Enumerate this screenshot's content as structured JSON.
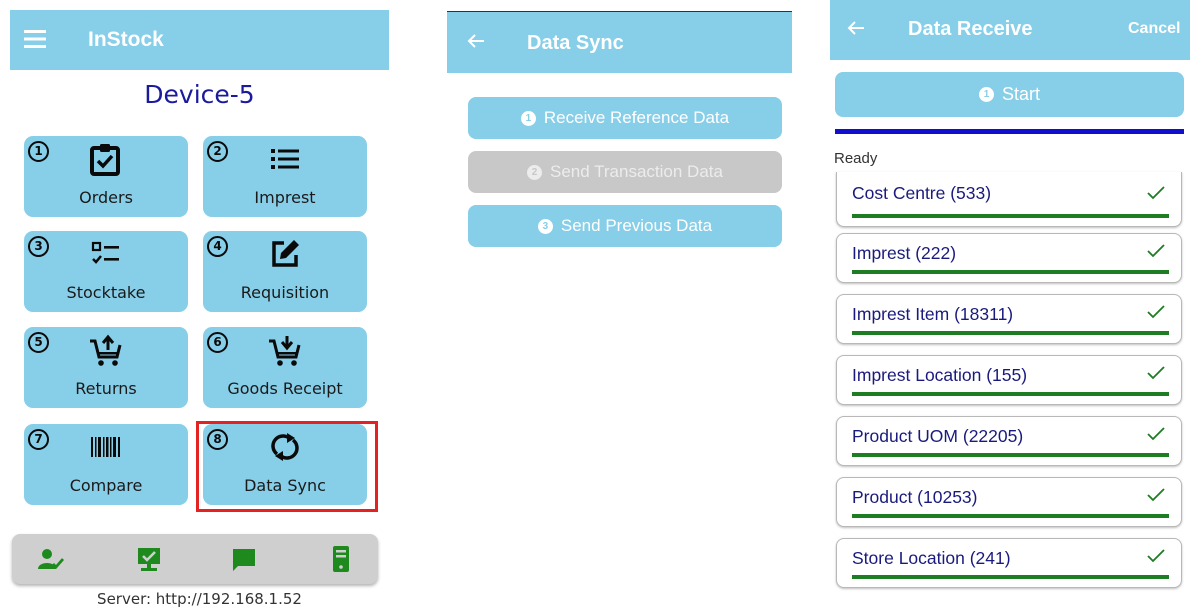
{
  "home": {
    "app_title": "InStock",
    "device_name": "Device-5",
    "tiles": [
      {
        "num": "1",
        "label": "Orders",
        "icon": "clipboard-check-icon"
      },
      {
        "num": "2",
        "label": "Imprest",
        "icon": "list-icon"
      },
      {
        "num": "3",
        "label": "Stocktake",
        "icon": "checklist-icon"
      },
      {
        "num": "4",
        "label": "Requisition",
        "icon": "edit-square-icon"
      },
      {
        "num": "5",
        "label": "Returns",
        "icon": "cart-upload-icon"
      },
      {
        "num": "6",
        "label": "Goods Receipt",
        "icon": "cart-download-icon"
      },
      {
        "num": "7",
        "label": "Compare",
        "icon": "barcode-icon"
      },
      {
        "num": "8",
        "label": "Data Sync",
        "icon": "sync-icon"
      }
    ],
    "bottom_icons": [
      "user-check-icon",
      "monitor-check-icon",
      "chat-icon",
      "phone-device-icon"
    ],
    "server_text": "Server: http://192.168.1.52",
    "highlight_color": "#e52222"
  },
  "sync": {
    "title": "Data Sync",
    "buttons": [
      {
        "num": "1",
        "label": "Receive Reference Data",
        "enabled": true
      },
      {
        "num": "2",
        "label": "Send Transaction Data",
        "enabled": false
      },
      {
        "num": "3",
        "label": "Send Previous Data",
        "enabled": true
      }
    ]
  },
  "receive": {
    "title": "Data Receive",
    "cancel_label": "Cancel",
    "start_num": "1",
    "start_label": "Start",
    "status": "Ready",
    "items": [
      {
        "label": "Cost Centre  (533)",
        "done": true
      },
      {
        "label": "Imprest  (222)",
        "done": true
      },
      {
        "label": "Imprest Item  (18311)",
        "done": true
      },
      {
        "label": "Imprest Location  (155)",
        "done": true
      },
      {
        "label": "Product UOM  (22205)",
        "done": true
      },
      {
        "label": "Product  (10253)",
        "done": true
      },
      {
        "label": "Store Location  (241)",
        "done": true
      }
    ]
  },
  "colors": {
    "header": "#87cee8",
    "tile": "#87cee8",
    "device_title": "#1a1a9e",
    "progress": "#1e7d22",
    "divider": "#1010cc",
    "disabled": "#c8c8c8"
  }
}
